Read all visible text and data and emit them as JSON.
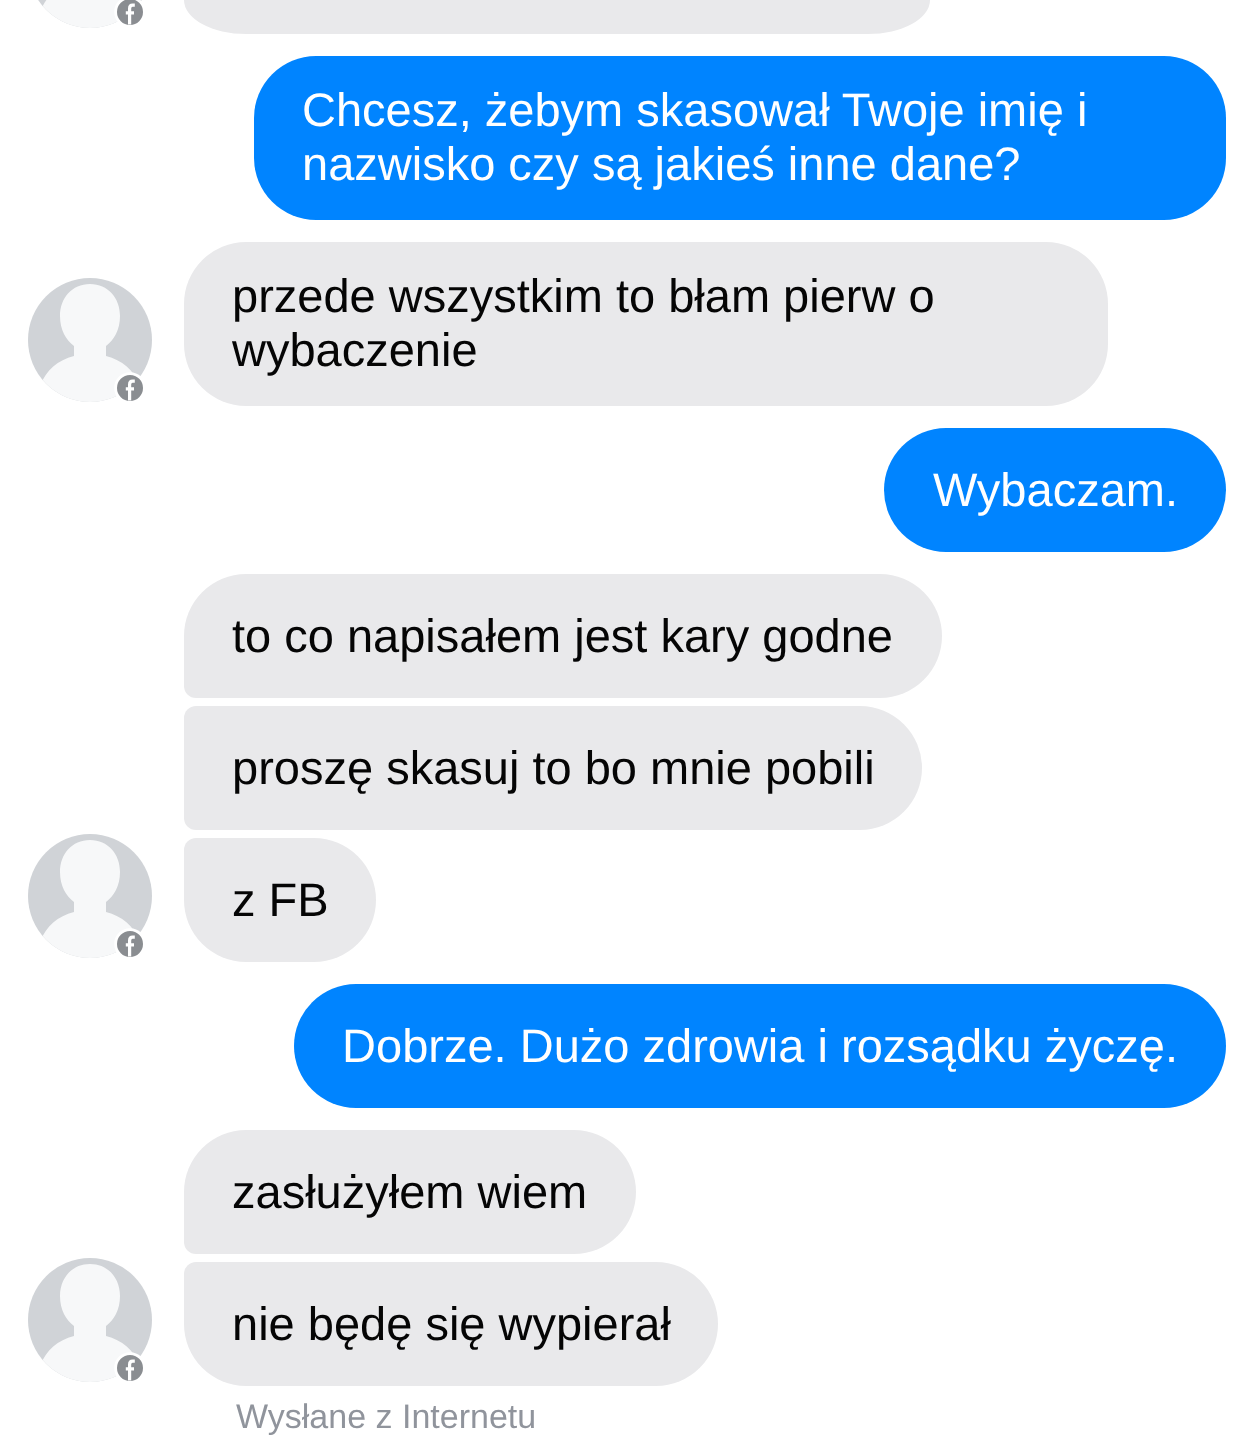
{
  "thread": [
    {
      "kind": "cut-off",
      "outgoing": false
    },
    {
      "kind": "messages",
      "outgoing": true,
      "messages": [
        "Chcesz, żebym skasował Twoje imię i nazwisko czy są jakieś inne dane?"
      ]
    },
    {
      "kind": "messages",
      "outgoing": false,
      "messages": [
        "przede wszystkim to błam pierw o wybaczenie"
      ]
    },
    {
      "kind": "messages",
      "outgoing": true,
      "messages": [
        "Wybaczam."
      ]
    },
    {
      "kind": "messages",
      "outgoing": false,
      "messages": [
        "to co napisałem jest kary godne",
        "proszę skasuj to bo mnie pobili",
        "z FB"
      ]
    },
    {
      "kind": "messages",
      "outgoing": true,
      "messages": [
        "Dobrze. Dużo zdrowia i rozsądku życzę."
      ]
    },
    {
      "kind": "messages",
      "outgoing": false,
      "messages": [
        "zasłużyłem wiem",
        "nie będę się wypierał"
      ]
    }
  ],
  "sent_via": "Wysłane z Internetu"
}
